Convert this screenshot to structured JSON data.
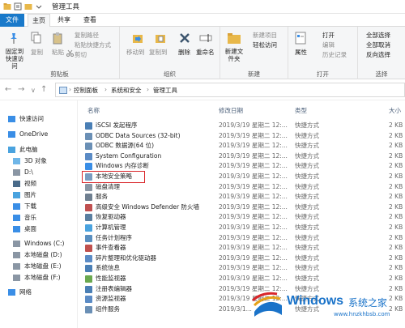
{
  "window": {
    "title": "管理工具"
  },
  "tabs": [
    {
      "label": "文件"
    },
    {
      "label": "主页"
    },
    {
      "label": "共享"
    },
    {
      "label": "查看"
    }
  ],
  "ribbon": {
    "clipboard": {
      "pin": "固定到快速访问",
      "copy": "复制",
      "paste": "粘贴",
      "copy_path": "复制路径",
      "paste_shortcut": "粘贴快捷方式",
      "cut": "剪切",
      "label": "剪贴板"
    },
    "organize": {
      "move_to": "移动到",
      "copy_to": "复制到",
      "delete": "删除",
      "rename": "重命名",
      "label": "组织"
    },
    "new": {
      "new_folder": "新建文件夹",
      "new_item": "新建项目",
      "easy_access": "轻松访问",
      "label": "新建"
    },
    "open": {
      "properties": "属性",
      "open": "打开",
      "edit": "编辑",
      "history": "历史记录",
      "label": "打开"
    },
    "select": {
      "select_all": "全部选择",
      "select_none": "全部取消",
      "invert": "反向选择",
      "label": "选择"
    }
  },
  "address": {
    "crumbs": [
      "控制面板",
      "系统和安全",
      "管理工具"
    ]
  },
  "nav": [
    {
      "label": "快速访问",
      "icon": "star-icon"
    },
    {
      "label": "OneDrive",
      "icon": "cloud-icon"
    },
    {
      "label": "此电脑",
      "icon": "computer-icon"
    },
    {
      "label": "3D 对象",
      "icon": "cube-icon"
    },
    {
      "label": "D:\\",
      "icon": "drive-icon"
    },
    {
      "label": "视频",
      "icon": "video-icon"
    },
    {
      "label": "图片",
      "icon": "picture-icon"
    },
    {
      "label": "下载",
      "icon": "download-icon"
    },
    {
      "label": "音乐",
      "icon": "music-icon"
    },
    {
      "label": "桌面",
      "icon": "desktop-icon"
    },
    {
      "label": "Windows (C:)",
      "icon": "drive-icon"
    },
    {
      "label": "本地磁盘 (D:)",
      "icon": "drive-icon"
    },
    {
      "label": "本地磁盘 (E:)",
      "icon": "drive-icon"
    },
    {
      "label": "本地磁盘 (F:)",
      "icon": "drive-icon"
    },
    {
      "label": "网络",
      "icon": "network-icon"
    }
  ],
  "columns": {
    "name": "名称",
    "date": "修改日期",
    "type": "类型",
    "size": "大小"
  },
  "files": [
    {
      "name": "iSCSI 发起程序",
      "date": "2019/3/19 星期二 12:...",
      "type": "快捷方式",
      "size": "2 KB"
    },
    {
      "name": "ODBC Data Sources (32-bit)",
      "date": "2019/3/19 星期二 12:...",
      "type": "快捷方式",
      "size": "2 KB"
    },
    {
      "name": "ODBC 数据源(64 位)",
      "date": "2019/3/19 星期二 12:...",
      "type": "快捷方式",
      "size": "2 KB"
    },
    {
      "name": "System Configuration",
      "date": "2019/3/19 星期二 12:...",
      "type": "快捷方式",
      "size": "2 KB"
    },
    {
      "name": "Windows 内存诊断",
      "date": "2019/3/19 星期二 12:...",
      "type": "快捷方式",
      "size": "2 KB"
    },
    {
      "name": "本地安全策略",
      "date": "2019/3/19 星期二 12:...",
      "type": "快捷方式",
      "size": "2 KB"
    },
    {
      "name": "磁盘清理",
      "date": "2019/3/19 星期二 12:...",
      "type": "快捷方式",
      "size": "2 KB"
    },
    {
      "name": "服务",
      "date": "2019/3/19 星期二 12:...",
      "type": "快捷方式",
      "size": "2 KB"
    },
    {
      "name": "高级安全 Windows Defender 防火墙",
      "date": "2019/3/19 星期二 12:...",
      "type": "快捷方式",
      "size": "2 KB"
    },
    {
      "name": "恢复驱动器",
      "date": "2019/3/19 星期二 12:...",
      "type": "快捷方式",
      "size": "2 KB"
    },
    {
      "name": "计算机管理",
      "date": "2019/3/19 星期二 12:...",
      "type": "快捷方式",
      "size": "2 KB"
    },
    {
      "name": "任务计划程序",
      "date": "2019/3/19 星期二 12:...",
      "type": "快捷方式",
      "size": "2 KB"
    },
    {
      "name": "事件查看器",
      "date": "2019/3/19 星期二 12:...",
      "type": "快捷方式",
      "size": "2 KB"
    },
    {
      "name": "碎片整理和优化驱动器",
      "date": "2019/3/19 星期二 12:...",
      "type": "快捷方式",
      "size": "2 KB"
    },
    {
      "name": "系统信息",
      "date": "2019/3/19 星期二 12:...",
      "type": "快捷方式",
      "size": "2 KB"
    },
    {
      "name": "性能监视器",
      "date": "2019/3/19 星期二 12:...",
      "type": "快捷方式",
      "size": "2 KB"
    },
    {
      "name": "注册表编辑器",
      "date": "2019/3/19 星期二 12:...",
      "type": "快捷方式",
      "size": "2 KB"
    },
    {
      "name": "资源监视器",
      "date": "2019/3/19 星期二 12:...",
      "type": "快捷方式",
      "size": "2 KB"
    },
    {
      "name": "组件服务",
      "date": "2019/3/1...",
      "type": "快捷方式",
      "size": "2 KB"
    }
  ],
  "watermark": {
    "brand": "Windows",
    "site": "系统之家",
    "url": "www.hnzkhbsb.com"
  },
  "colors": {
    "file_tab": "#1979ca",
    "highlight": "#d9262a",
    "folder": "#e8b84a",
    "watermark": "#1a73c9"
  }
}
